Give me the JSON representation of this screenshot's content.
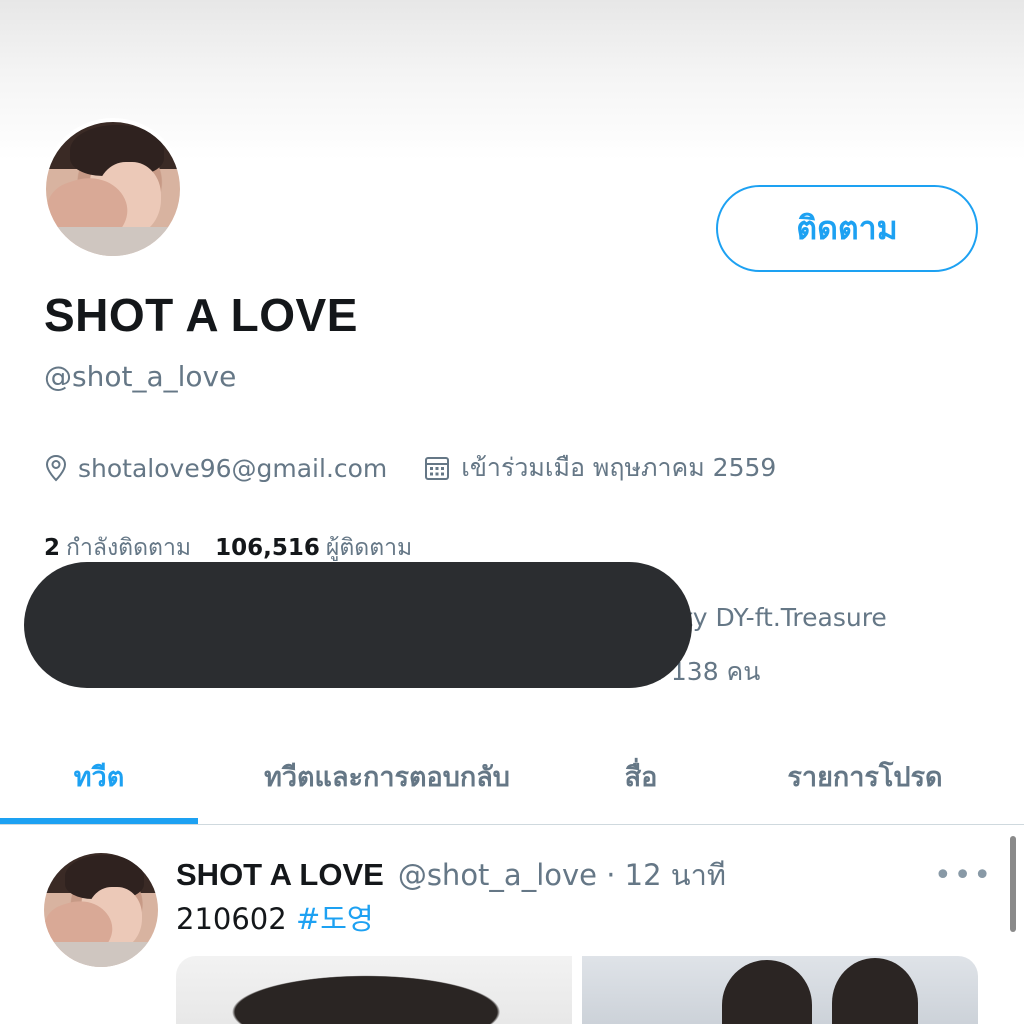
{
  "profile": {
    "display_name": "SHOT A LOVE",
    "handle": "@shot_a_love",
    "follow_button": "ติดตาม",
    "location": "shotalove96@gmail.com",
    "joined": "เข้าร่วมเมือ พฤษภาคม 2559",
    "following_count": "2",
    "following_label": "กำลังติดตาม",
    "followers_count": "106,516",
    "followers_label": "ผู้ติดตาม",
    "bio_visible_1": "ity DY-ft.Treasure",
    "bio_visible_2": "ı 138 คน",
    "icons": {
      "location": "location-pin-icon",
      "joined": "calendar-icon"
    }
  },
  "tabs": [
    {
      "label": "ทวีต",
      "active": true
    },
    {
      "label": "ทวีตและการตอบกลับ",
      "active": false
    },
    {
      "label": "สื่อ",
      "active": false
    },
    {
      "label": "รายการโปรด",
      "active": false
    }
  ],
  "tweet": {
    "name": "SHOT A LOVE",
    "meta": "@shot_a_love · 12 นาที",
    "more": "•••",
    "text": "210602",
    "hashtag": "#도영"
  },
  "colors": {
    "accent": "#1da1f2",
    "muted": "#657786",
    "text": "#14171a",
    "redaction": "#2b2d30"
  }
}
